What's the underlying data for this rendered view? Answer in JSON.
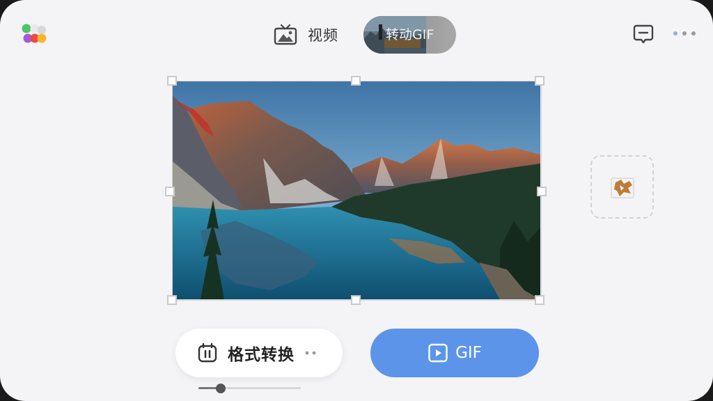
{
  "header": {
    "logo_icon": "app-logo-icon",
    "tabs": [
      {
        "label": "视频",
        "icon": "video-tv-icon",
        "active": false
      },
      {
        "label": "转动GIF",
        "icon": "gif-thumbnail",
        "active": true
      }
    ],
    "message_icon": "message-icon",
    "more_icon": "more-dots-icon"
  },
  "canvas": {
    "image_subject": "mountain lake landscape",
    "selection_handles": 8
  },
  "side_panel": {
    "icon": "image-placeholder-icon"
  },
  "controls": {
    "format_button": {
      "label": "格式转换",
      "icon": "pause-calendar-icon",
      "extra_icon": "more-dots-icon"
    },
    "gif_button": {
      "label": "GIF",
      "icon": "play-icon"
    },
    "slider": {
      "value": 0.22
    }
  },
  "colors": {
    "accent": "#5c94ea",
    "background": "#f4f4f6"
  }
}
